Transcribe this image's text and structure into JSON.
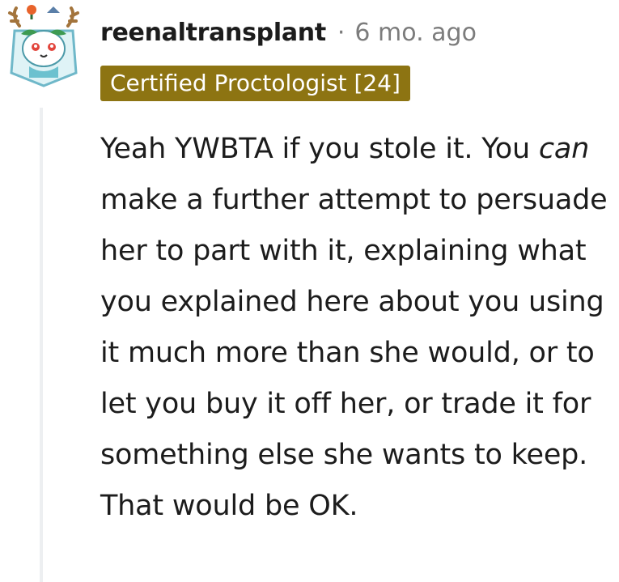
{
  "comment": {
    "author": "reenaltransplant",
    "separator": "·",
    "timestamp": "6 mo. ago",
    "flair": "Certified Proctologist [24]",
    "body": {
      "part1": "Yeah YWBTA if you stole it. You ",
      "emphasis": "can",
      "part2": " make a further attempt to persuade her to part with it, explaining what you explained here about you using it much more than she would, or to let you buy it off her, or trade it for something else she wants to keep. That would be OK."
    }
  },
  "icons": {
    "avatar": "snoo-avatar-icon"
  },
  "colors": {
    "flair_background": "#8d7412",
    "flair_text": "#ffffff",
    "username": "#1c1c1c",
    "meta_text": "#7c7c7c",
    "thread_line": "#edeff1",
    "body_text": "#1c1c1c"
  }
}
